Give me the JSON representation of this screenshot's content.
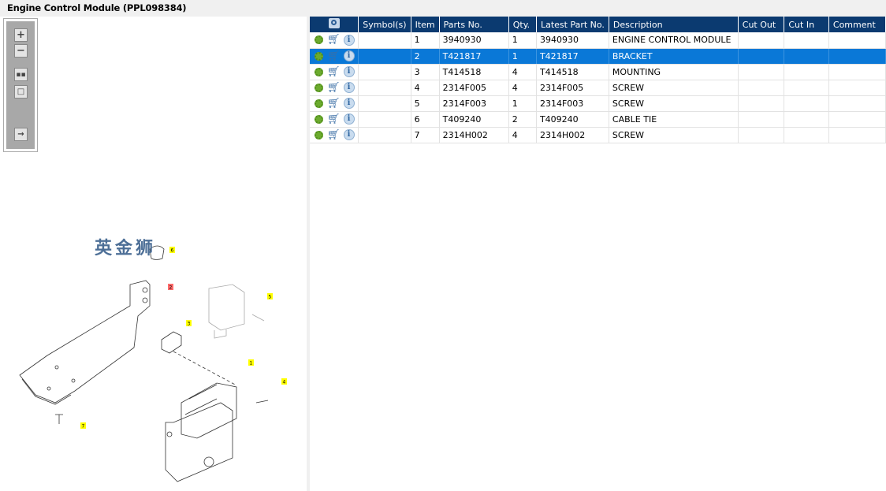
{
  "title": "Engine Control Module (PPL098384)",
  "toolbar": {
    "buttons": [
      "zoom-in",
      "zoom-out",
      "fit-all",
      "fit-window",
      "export"
    ]
  },
  "diagram": {
    "callouts": [
      {
        "n": "1",
        "hl": false
      },
      {
        "n": "2",
        "hl": true
      },
      {
        "n": "3",
        "hl": false
      },
      {
        "n": "4",
        "hl": false
      },
      {
        "n": "5",
        "hl": false
      },
      {
        "n": "6",
        "hl": false
      },
      {
        "n": "7",
        "hl": false
      }
    ]
  },
  "table": {
    "headers": [
      "Symbol(s)",
      "Item",
      "Parts No.",
      "Qty.",
      "Latest Part No.",
      "Description",
      "Cut Out",
      "Cut In",
      "Comment"
    ],
    "selected_index": 1,
    "rows": [
      {
        "item": "1",
        "part": "3940930",
        "qty": "1",
        "latest": "3940930",
        "desc": "ENGINE CONTROL MODULE"
      },
      {
        "item": "2",
        "part": "T421817",
        "qty": "1",
        "latest": "T421817",
        "desc": "BRACKET"
      },
      {
        "item": "3",
        "part": "T414518",
        "qty": "4",
        "latest": "T414518",
        "desc": "MOUNTING"
      },
      {
        "item": "4",
        "part": "2314F005",
        "qty": "4",
        "latest": "2314F005",
        "desc": "SCREW"
      },
      {
        "item": "5",
        "part": "2314F003",
        "qty": "1",
        "latest": "2314F003",
        "desc": "SCREW"
      },
      {
        "item": "6",
        "part": "T409240",
        "qty": "2",
        "latest": "T409240",
        "desc": "CABLE TIE"
      },
      {
        "item": "7",
        "part": "2314H002",
        "qty": "4",
        "latest": "2314H002",
        "desc": "SCREW"
      }
    ]
  },
  "watermark": "英金狮",
  "colors": {
    "header": "#0b3a70",
    "selected": "#0a78d7",
    "callout": "#ffff00",
    "callout_selected": "#ff6b6b"
  }
}
